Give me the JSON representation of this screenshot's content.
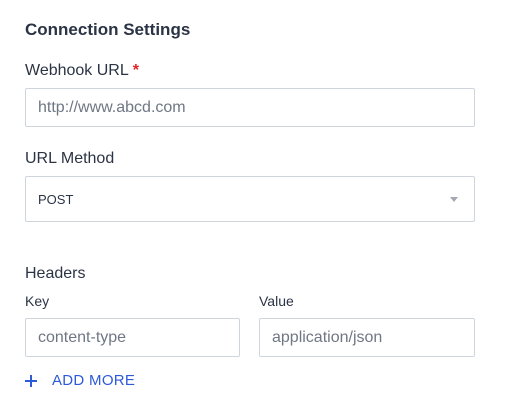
{
  "section": {
    "title": "Connection Settings"
  },
  "webhook": {
    "label": "Webhook URL",
    "required_marker": "*",
    "value": "http://www.abcd.com"
  },
  "url_method": {
    "label": "URL Method",
    "selected": "POST"
  },
  "headers": {
    "title": "Headers",
    "key_label": "Key",
    "value_label": "Value",
    "rows": [
      {
        "key": "content-type",
        "value": "application/json"
      }
    ],
    "add_more_label": "ADD MORE"
  },
  "icons": {
    "select_arrow": "caret-down-icon",
    "add": "plus-icon"
  },
  "colors": {
    "accent": "#2d5bd7",
    "required": "#e02424",
    "text": "#2b3445",
    "border": "#cfd5dd"
  }
}
